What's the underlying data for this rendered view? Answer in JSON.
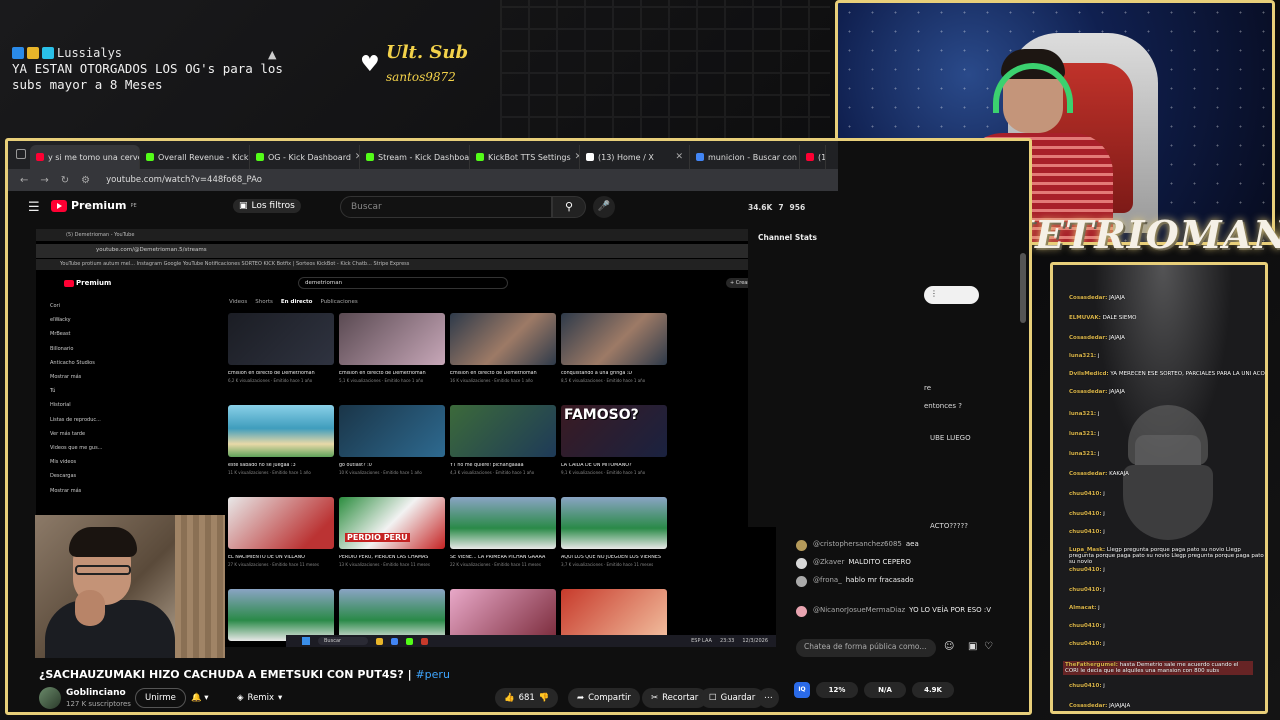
{
  "overlay": {
    "alert_user": "Lussialys",
    "alert_text": "YA ESTAN OTORGADOS LOS OG's para los subs mayor a 8 Meses",
    "ult_sub_label": "Ult. Sub",
    "ult_sub_name": "santos9872",
    "streamer_name": "DEMETRIOMAN"
  },
  "browser": {
    "tabs": [
      {
        "label": "y si me tomo una cerveza",
        "color": "#ff0033"
      },
      {
        "label": "Overall Revenue - Kick Da",
        "color": "#53fc18"
      },
      {
        "label": "OG - Kick Dashboard",
        "color": "#53fc18"
      },
      {
        "label": "Stream - Kick Dashboard",
        "color": "#53fc18"
      },
      {
        "label": "KickBot TTS Settings",
        "color": "#53fc18"
      },
      {
        "label": "(13) Home / X",
        "color": "#ffffff"
      },
      {
        "label": "municion - Buscar con Go",
        "color": "#4285f4"
      },
      {
        "label": "(1)",
        "color": "#ff0033"
      }
    ],
    "url": "youtube.com/watch?v=448fo68_PAo"
  },
  "youtube": {
    "logo": "Premium",
    "logo_sup": "PE",
    "filters": "Los filtros",
    "search_placeholder": "Buscar",
    "stats": [
      "34.6K",
      "7",
      "956"
    ],
    "chat_stats": "Channel Stats",
    "video_title": "¿SACHAUZUMAKI HIZO CACHUDA A EMETSUKI CON PUT4S? |",
    "video_tag": "#peru",
    "channel_name": "Goblinciano",
    "subscribers": "127 K suscriptores",
    "join": "Unirme",
    "remix": "Remix",
    "likes": "681",
    "share": "Compartir",
    "clip": "Recortar",
    "save": "Guardar"
  },
  "inner": {
    "tab_title": "(5) Demetrioman - YouTube",
    "url": "youtube.com/@Demetrioman.5/streams",
    "bookmarks": "YouTube   protium autum mel...   Instagram   Google   YouTube   Notificaciones   SORTEO KICK   Botfix | Sorteos   KickBot - Kick Chatb...   Stripe Express",
    "logo": "Premium",
    "search": "demetrioman",
    "crear": "+ Crear",
    "sidebar": [
      "Cori",
      "elWacky",
      "MrBeast",
      "Billonario",
      "Anticacho Studios",
      "Mostrar más",
      "Tú",
      "Historial",
      "Listas de reproduc...",
      "Ver más tarde",
      "Videos que me gus...",
      "Mis videos",
      "Descargas",
      "Mostrar más"
    ],
    "subtabs": [
      "Videos",
      "Shorts",
      "En directo",
      "Publicaciones"
    ],
    "videos": [
      {
        "title": "Emisión en directo de Demetrioman",
        "meta": "6,2 K visualizaciones · Emitido hace 1 año",
        "thumb": "th-dark",
        "overlay": ""
      },
      {
        "title": "Emisión en directo de Demetrioman",
        "meta": "5,1 K visualizaciones · Emitido hace 1 año",
        "thumb": "th-shop",
        "overlay": ""
      },
      {
        "title": "Emisión en directo de Demetrioman",
        "meta": "16 K visualizaciones · Emitido hace 1 año",
        "thumb": "th-face",
        "overlay": ""
      },
      {
        "title": "conquistando a una gringa :D",
        "meta": "8,5 K visualizaciones · Emitido hace 1 año",
        "thumb": "th-face",
        "overlay": ""
      },
      {
        "title": "este sabado no se juegaa :3",
        "meta": "11 K visualizaciones · Emitido hace 1 año",
        "thumb": "th-beach",
        "overlay": ""
      },
      {
        "title": "go outlast? :0",
        "meta": "10 K visualizaciones · Emitido hace 1 año",
        "thumb": "th-under",
        "overlay": ""
      },
      {
        "title": "YT no me quiere! pichangaaaa",
        "meta": "4,3 K visualizaciones · Emitido hace 1 año",
        "thumb": "th-green",
        "overlay": ""
      },
      {
        "title": "LA CAIDA DE UN MITOMANO?",
        "meta": "9,1 K visualizaciones · Emitido hace 1 año",
        "thumb": "th-famoso",
        "overlay": "FAMOSO?"
      },
      {
        "title": "EL NACIMIENTO DE UN VILLANO",
        "meta": "27 K visualizaciones · Emitido hace 11 meses",
        "thumb": "th-meme",
        "overlay": ""
      },
      {
        "title": "PERDIO PERU, PIERDEN LAS CHAMAS",
        "meta": "13 K visualizaciones · Emitido hace 11 meses",
        "thumb": "th-peru",
        "overlay": "PERDIO PERU"
      },
      {
        "title": "SE VIENE... LA PRIMERA PICHAN GAAAA",
        "meta": "22 K visualizaciones · Emitido hace 11 meses",
        "thumb": "th-team",
        "overlay": ""
      },
      {
        "title": "AQUI LOS QUE NO JUEGUEN LOS VIERNES",
        "meta": "3,7 K visualizaciones · Emitido hace 11 meses",
        "thumb": "th-team",
        "overlay": ""
      },
      {
        "title": "",
        "meta": "",
        "thumb": "th-team",
        "overlay": ""
      },
      {
        "title": "",
        "meta": "",
        "thumb": "th-team",
        "overlay": ""
      },
      {
        "title": "",
        "meta": "",
        "thumb": "th-pink",
        "overlay": ""
      },
      {
        "title": "",
        "meta": "",
        "thumb": "th-red",
        "overlay": ""
      }
    ],
    "taskbar_search": "Buscar",
    "taskbar_time": "23:33",
    "taskbar_date": "12/3/2026",
    "taskbar_lang": "ESP LAA"
  },
  "yt_chat": {
    "ghost": [
      "re",
      "entonces ?",
      "UBE LUEGO",
      "ACTO?????"
    ],
    "messages": [
      {
        "user": "@cristophersanchez6085",
        "text": "aea",
        "color": "#b59a5a"
      },
      {
        "user": "@Zkaver",
        "text": "MALDITO CEPERO",
        "color": "#d8d8d8"
      },
      {
        "user": "@frona_",
        "text": "hablo mr fracasado",
        "color": "#aaaaaa"
      },
      {
        "user": "@NicanorJosueMermaDiaz",
        "text": "YO LO VEÍA POR ESO :V",
        "color": "#e8a4b0"
      }
    ],
    "input_placeholder": "Chatea de forma pública como...",
    "stats": [
      "12%",
      "N/A",
      "4.9K"
    ],
    "k_badge": "IQ"
  },
  "stream_chat": [
    {
      "user": "Cosasdedar:",
      "text": "JAJAJA"
    },
    {
      "user": "ELMUVAK:",
      "text": "DALE SIEMO"
    },
    {
      "user": "Cosasdedar:",
      "text": "JAJAJA"
    },
    {
      "user": "luna321:",
      "text": "j"
    },
    {
      "user": "DvilsMedicd:",
      "text": "YA MERECEN ESE SORTEO, PARCIALES PARA LA UNI ACORDADA"
    },
    {
      "user": "Cosasdedar:",
      "text": "JAJAJA"
    },
    {
      "user": "luna321:",
      "text": "j"
    },
    {
      "user": "luna321:",
      "text": "j"
    },
    {
      "user": "luna321:",
      "text": "j"
    },
    {
      "user": "Cosasdedar:",
      "text": "KAKAJA"
    },
    {
      "user": "chuu0410:",
      "text": "j"
    },
    {
      "user": "chuu0410:",
      "text": "j"
    },
    {
      "user": "chuu0410:",
      "text": "j"
    },
    {
      "user": "Lupa_Mask:",
      "text": "Llegp pregunta porque paga pato su novio Llegp pregunta porque paga pato su novio Llegp pregunta porque paga pato su novio"
    },
    {
      "user": "chuu0410:",
      "text": "j"
    },
    {
      "user": "chuu0410:",
      "text": "j"
    },
    {
      "user": "Almacat:",
      "text": "j"
    },
    {
      "user": "chuu0410:",
      "text": "j"
    },
    {
      "user": "chuu0410:",
      "text": "j"
    },
    {
      "user": "TheFathergumel:",
      "text": "hasta Demetrio sale me acuerdo cuando el CORI le decia que le alquiles una mansion con 800 subs"
    },
    {
      "user": "chuu0410:",
      "text": "j"
    },
    {
      "user": "Cosasdedar:",
      "text": "JAJAJAJA"
    }
  ]
}
